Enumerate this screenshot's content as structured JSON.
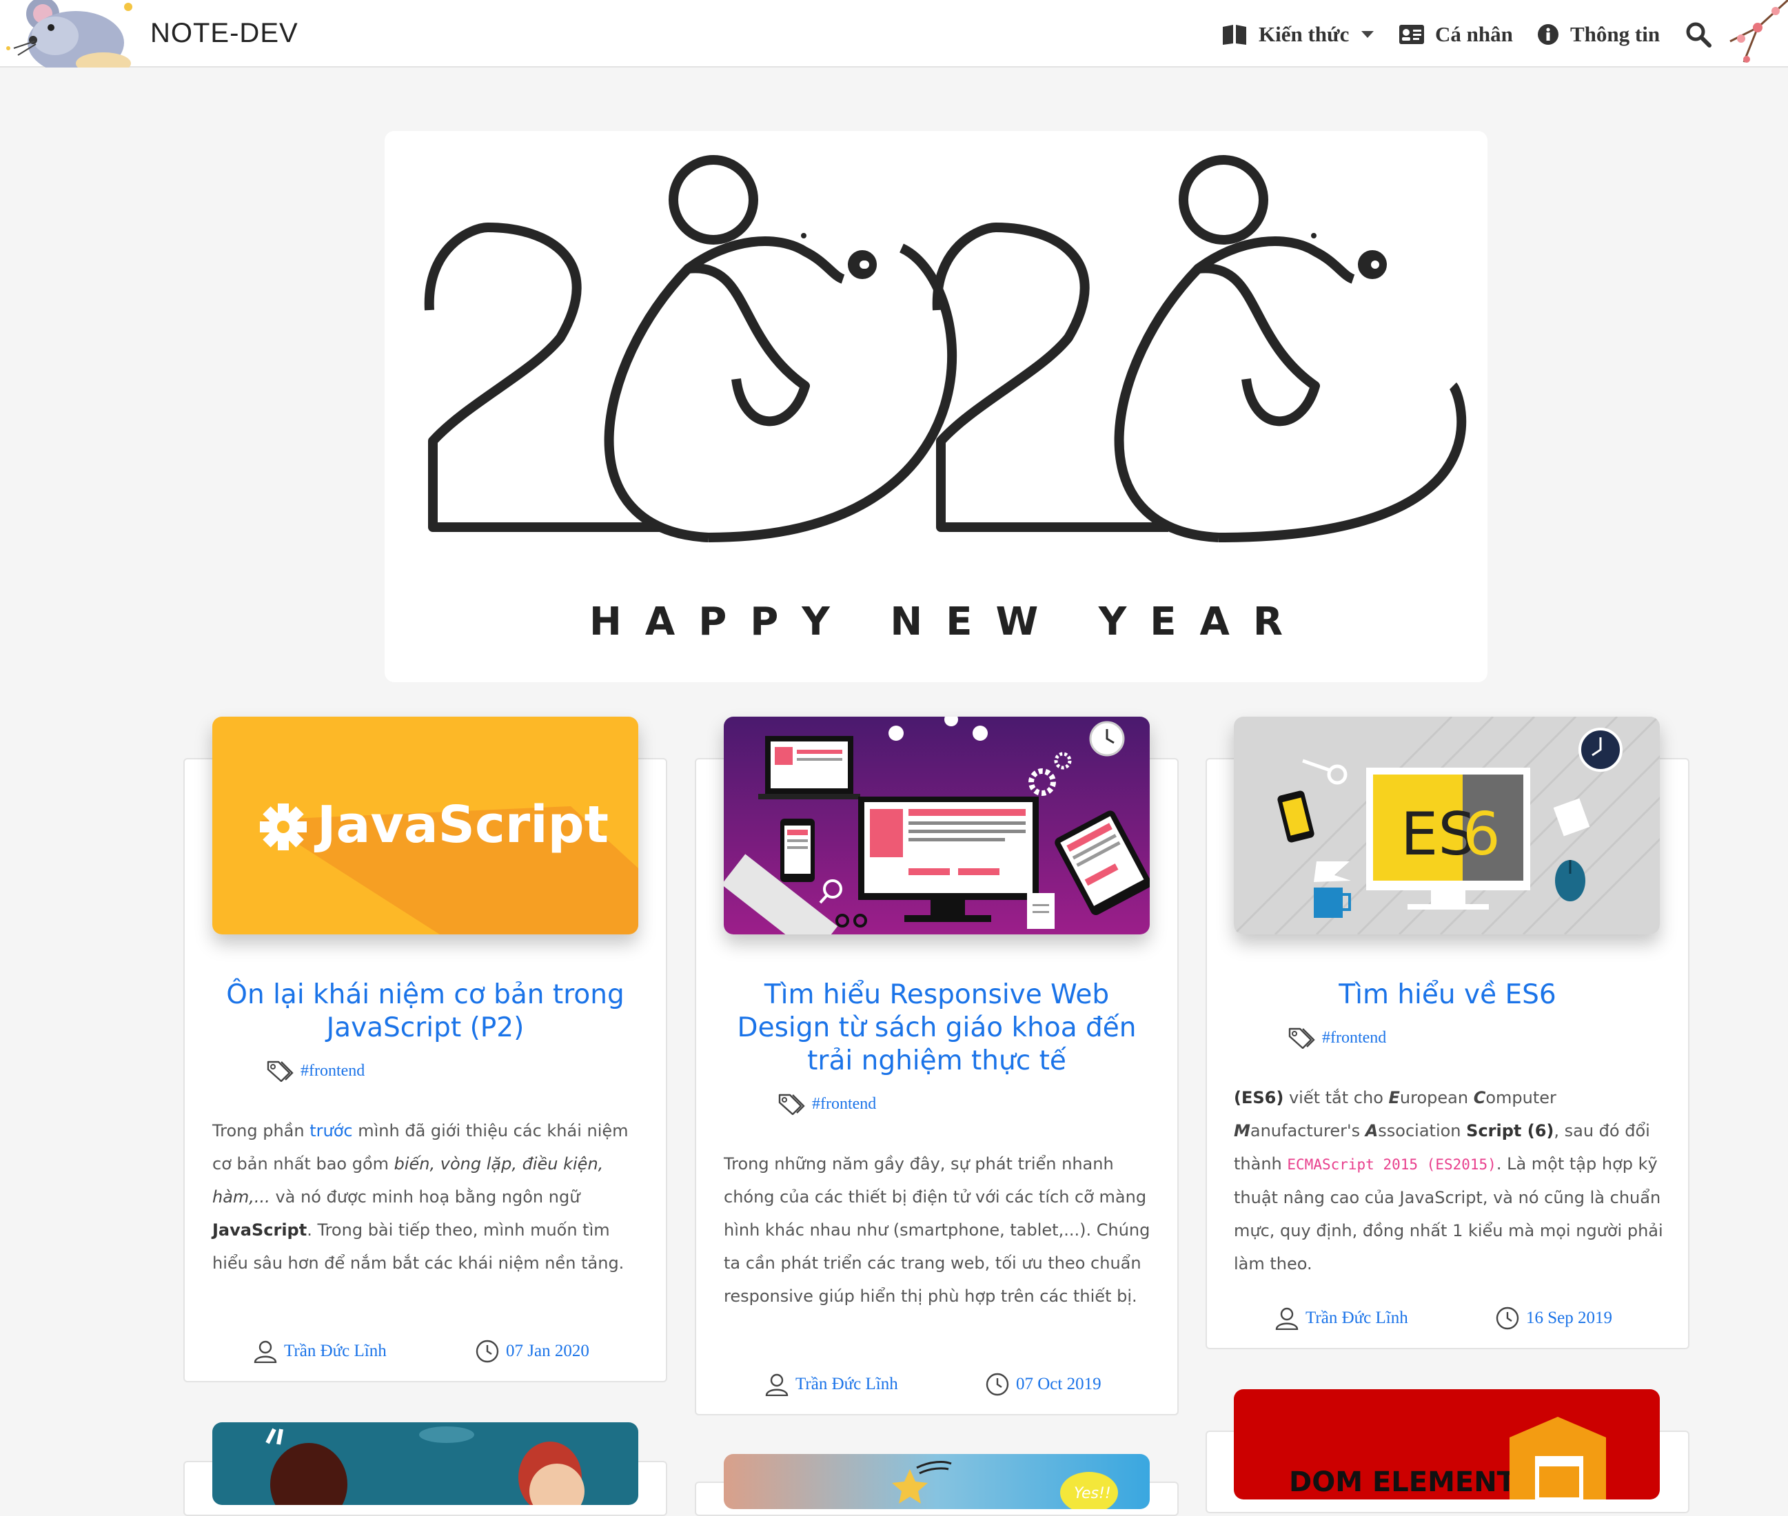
{
  "header": {
    "brand": "NOTE-DEV",
    "nav": [
      {
        "label": "Kiến thức",
        "icon": "book-icon",
        "has_dropdown": true
      },
      {
        "label": "Cá nhân",
        "icon": "id-card-icon"
      },
      {
        "label": "Thông tin",
        "icon": "info-circle-icon"
      }
    ]
  },
  "banner": {
    "year": "2020",
    "greeting": "HAPPY NEW YEAR"
  },
  "posts": [
    {
      "thumb_text": "JavaScript",
      "title": "Ôn lại khái niệm cơ bản trong JavaScript (P2)",
      "tag": "#frontend",
      "excerpt": {
        "p1": "Trong phần ",
        "link": "trước",
        "p2": " mình đã giới thiệu các khái niệm cơ bản nhất bao gồm ",
        "italic": "biến, vòng lặp, điều kiện, hàm,...",
        "p3": " và nó được minh hoạ bằng ngôn ngữ ",
        "bold": "JavaScript",
        "p4": ". Trong bài tiếp theo, mình muốn tìm hiểu sâu hơn để nắm bắt các khái niệm nền tảng."
      },
      "author": "Trần Đức Lĩnh",
      "date": "07 Jan 2020"
    },
    {
      "title": "Tìm hiểu Responsive Web Design từ sách giáo khoa đến trải nghiệm thực tế",
      "tag": "#frontend",
      "excerpt": {
        "text": "Trong những năm gầy đây, sự phát triển nhanh chóng của các thiết bị điện tử với các tích cỡ màng hình khác nhau như (smartphone, tablet,...). Chúng ta cần phát triển các trang web, tối ưu theo chuẩn responsive giúp hiển thị phù hợp trên các thiết bị."
      },
      "author": "Trần Đức Lĩnh",
      "date": "07 Oct 2019"
    },
    {
      "thumb_text_a": "ES",
      "thumb_text_b": "6",
      "title": "Tìm hiểu về ES6",
      "tag": "#frontend",
      "excerpt": {
        "b1": "(ES6)",
        "t1": " viết tắt cho ",
        "l_e": "E",
        "t_e": "uropean ",
        "l_c": "C",
        "t_c": "omputer ",
        "l_m": "M",
        "t_m": "anufacturer's ",
        "l_a": "A",
        "t_a": "ssociation ",
        "b2": "Script (6)",
        "t2": ", sau đó đổi thành ",
        "code": "ECMAScript 2015 (ES2015)",
        "t3": ". Là một tập hợp kỹ thuật nâng cao của JavaScript, và nó cũng là chuẩn mực, quy định, đồng nhất 1 kiểu mà mọi người phải làm theo."
      },
      "author": "Trần Đức Lĩnh",
      "date": "16 Sep 2019"
    }
  ],
  "partial_cards": {
    "dom_title": "DOM ELEMENTS",
    "yes_badge": "Yes!!"
  },
  "colors": {
    "link": "#1a73e8",
    "js_yellow": "#fdb827",
    "rwd_purple": "#6a1b7a",
    "es6_gray": "#d6d6d6",
    "dom_red": "#cc0000"
  }
}
